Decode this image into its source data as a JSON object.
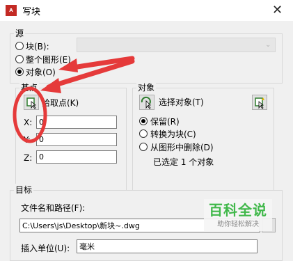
{
  "window": {
    "title": "写块",
    "app_icon_text": "A",
    "close_symbol": "✕"
  },
  "source": {
    "legend": "源",
    "options": [
      {
        "label": "块(B):",
        "selected": false
      },
      {
        "label": "整个图形(E)",
        "selected": false
      },
      {
        "label": "对象(O)",
        "selected": true
      }
    ],
    "block_combo_value": ""
  },
  "base_point": {
    "legend": "基点",
    "pick_label": "拾取点(K)",
    "x_label": "X:",
    "x_value": "0",
    "y_label": "Y:",
    "y_value": "0",
    "z_label": "Z:",
    "z_value": "0"
  },
  "objects": {
    "legend": "对象",
    "select_label": "选择对象(T)",
    "options": [
      {
        "label": "保留(R)",
        "selected": true
      },
      {
        "label": "转换为块(C)",
        "selected": false
      },
      {
        "label": "从图形中删除(D)",
        "selected": false
      }
    ],
    "status": "已选定 1 个对象"
  },
  "target": {
    "legend": "目标",
    "path_label": "文件名和路径(F):",
    "path_value": "C:\\Users\\js\\Desktop\\新块~.dwg",
    "units_label": "插入单位(U):",
    "units_value": "毫米"
  },
  "watermark": {
    "main": "百科全说",
    "sub": "助你轻松解决"
  },
  "colors": {
    "annotation_red": "#e53a3a",
    "watermark_green": "#40b84a"
  }
}
